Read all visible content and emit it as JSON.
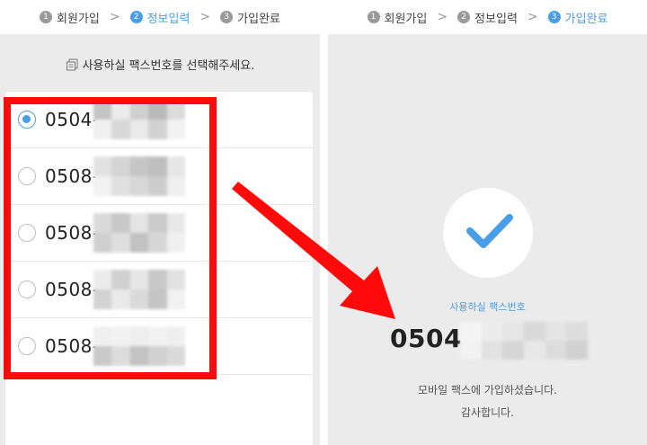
{
  "left_panel": {
    "steps": [
      {
        "num": "1",
        "label": "회원가입"
      },
      {
        "num": "2",
        "label": "정보입력"
      },
      {
        "num": "3",
        "label": "가입완료"
      }
    ],
    "step_separator": ">",
    "active_step": 2,
    "prompt": "사용하실 팩스번호를 선택해주세요.",
    "options": [
      {
        "prefix": "0504-",
        "checked": true
      },
      {
        "prefix": "0508-",
        "checked": false
      },
      {
        "prefix": "0508-",
        "checked": false
      },
      {
        "prefix": "0508-",
        "checked": false
      },
      {
        "prefix": "0508-",
        "checked": false
      }
    ]
  },
  "right_panel": {
    "steps": [
      {
        "num": "1",
        "label": "회원가입"
      },
      {
        "num": "2",
        "label": "정보입력"
      },
      {
        "num": "3",
        "label": "가입완료"
      }
    ],
    "step_separator": ">",
    "active_step": 3,
    "fax_label": "사용하실 팩스번호",
    "fax_number_prefix": "0504-",
    "message_line1": "모바일 팩스에 가입하셨습니다.",
    "message_line2": "감사합니다."
  },
  "colors": {
    "accent": "#4a9ee8",
    "highlight": "#ff0a0a",
    "panel_bg": "#ebebeb"
  },
  "icons": [
    "document-icon",
    "check-icon",
    "arrow-icon"
  ]
}
